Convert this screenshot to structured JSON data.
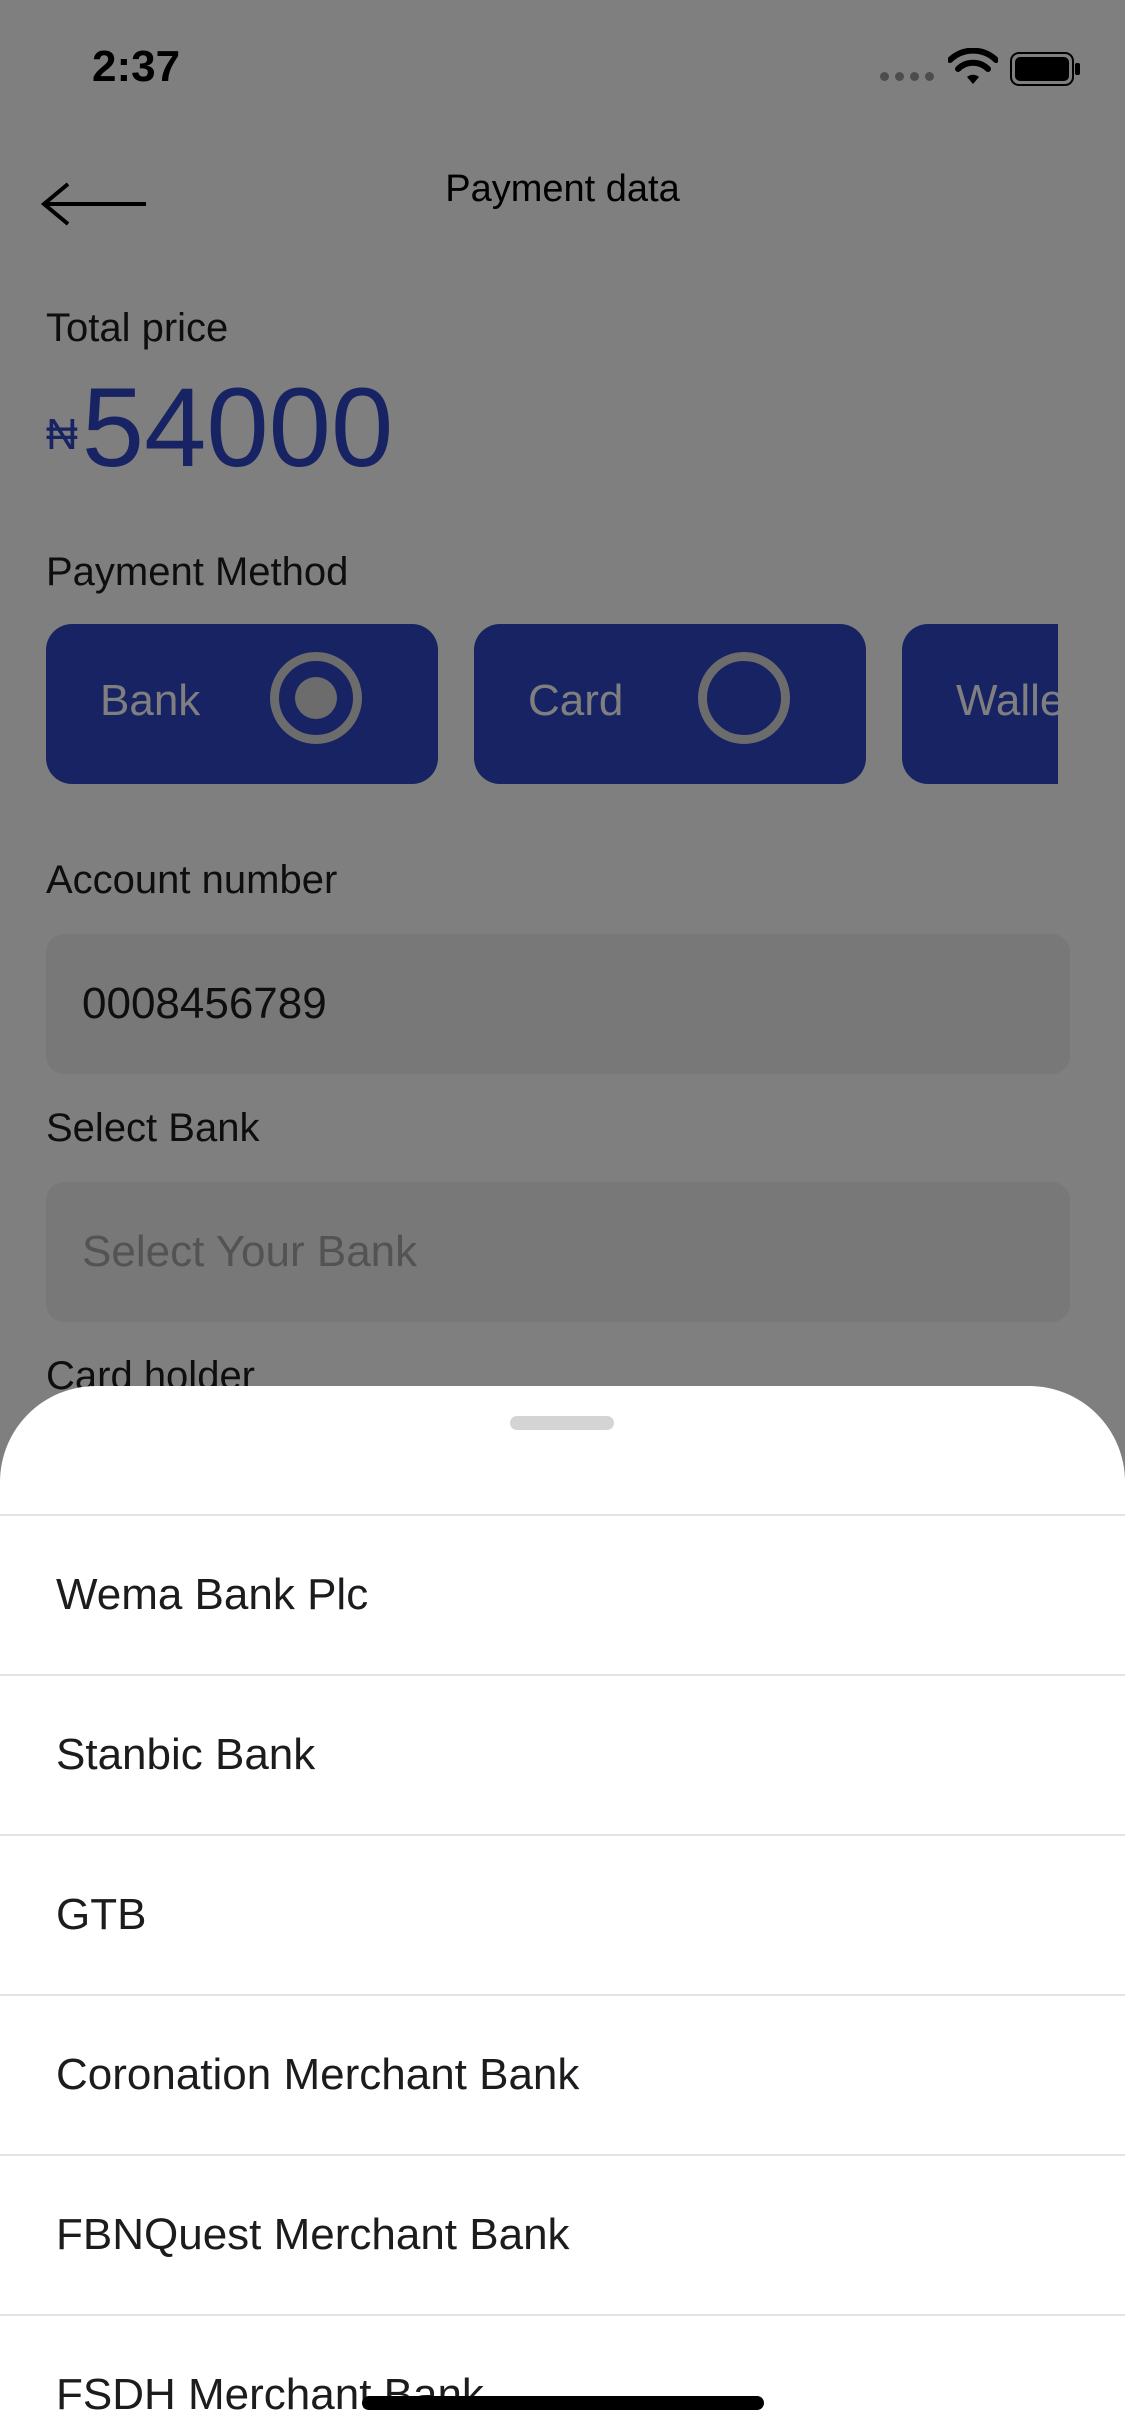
{
  "status": {
    "time": "2:37"
  },
  "header": {
    "title": "Payment data"
  },
  "total": {
    "label": "Total price",
    "currency": "₦",
    "amount": "54000"
  },
  "payment_method": {
    "label": "Payment Method",
    "options": [
      {
        "label": "Bank",
        "selected": true
      },
      {
        "label": "Card",
        "selected": false
      },
      {
        "label": "Walle",
        "selected": false
      }
    ]
  },
  "account": {
    "label": "Account number",
    "value": "0008456789"
  },
  "bank": {
    "label": "Select Bank",
    "placeholder": "Select Your Bank"
  },
  "card_holder": {
    "label": "Card holder"
  },
  "sheet": {
    "banks": [
      "Wema Bank Plc",
      "Stanbic Bank",
      "GTB",
      "Coronation Merchant Bank",
      "FBNQuest Merchant Bank",
      "FSDH Merchant Bank"
    ]
  },
  "colors": {
    "accent": "#2f46c7",
    "overlay": "rgba(0,0,0,0.5)"
  },
  "icons": {
    "back": "arrow-left-icon",
    "wifi": "wifi-icon",
    "battery": "battery-icon"
  }
}
